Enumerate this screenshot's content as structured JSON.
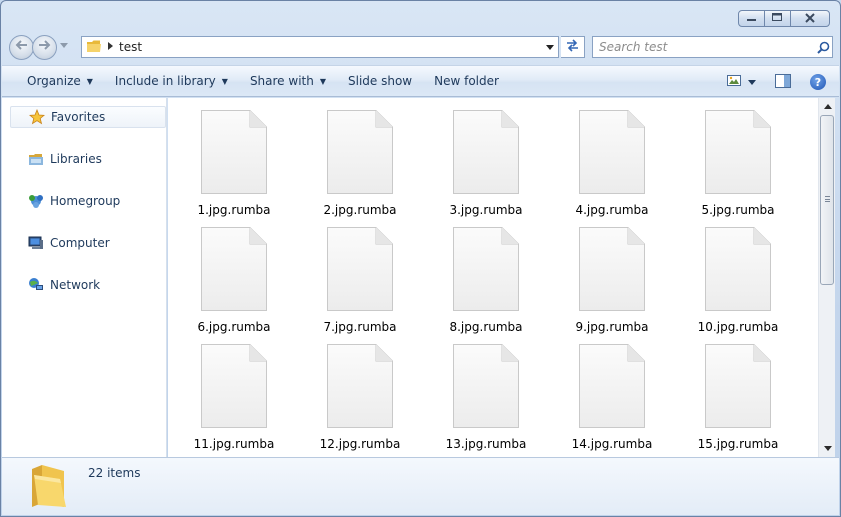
{
  "window": {
    "caption_buttons": {
      "minimize": "▭",
      "maximize": "▢",
      "close": "✕"
    }
  },
  "address_bar": {
    "path": "test",
    "refresh_glyph": "⇆"
  },
  "search": {
    "placeholder": "Search test"
  },
  "toolbar": {
    "organize": "Organize",
    "include_in_library": "Include in library",
    "share_with": "Share with",
    "slide_show": "Slide show",
    "new_folder": "New folder",
    "help": "?"
  },
  "navigation": {
    "items": [
      {
        "label": "Favorites",
        "icon": "star-icon"
      },
      {
        "label": "Libraries",
        "icon": "libraries-icon"
      },
      {
        "label": "Homegroup",
        "icon": "homegroup-icon"
      },
      {
        "label": "Computer",
        "icon": "computer-icon"
      },
      {
        "label": "Network",
        "icon": "network-icon"
      }
    ]
  },
  "files": [
    "1.jpg.rumba",
    "2.jpg.rumba",
    "3.jpg.rumba",
    "4.jpg.rumba",
    "5.jpg.rumba",
    "6.jpg.rumba",
    "7.jpg.rumba",
    "8.jpg.rumba",
    "9.jpg.rumba",
    "10.jpg.rumba",
    "11.jpg.rumba",
    "12.jpg.rumba",
    "13.jpg.rumba",
    "14.jpg.rumba",
    "15.jpg.rumba"
  ],
  "details": {
    "item_count": "22 items"
  },
  "colors": {
    "accent": "#1e395b",
    "window_frame": "#c3d5ec",
    "favorites_star": "#f2b31b",
    "folder_yellow": "#f3cf5c"
  }
}
